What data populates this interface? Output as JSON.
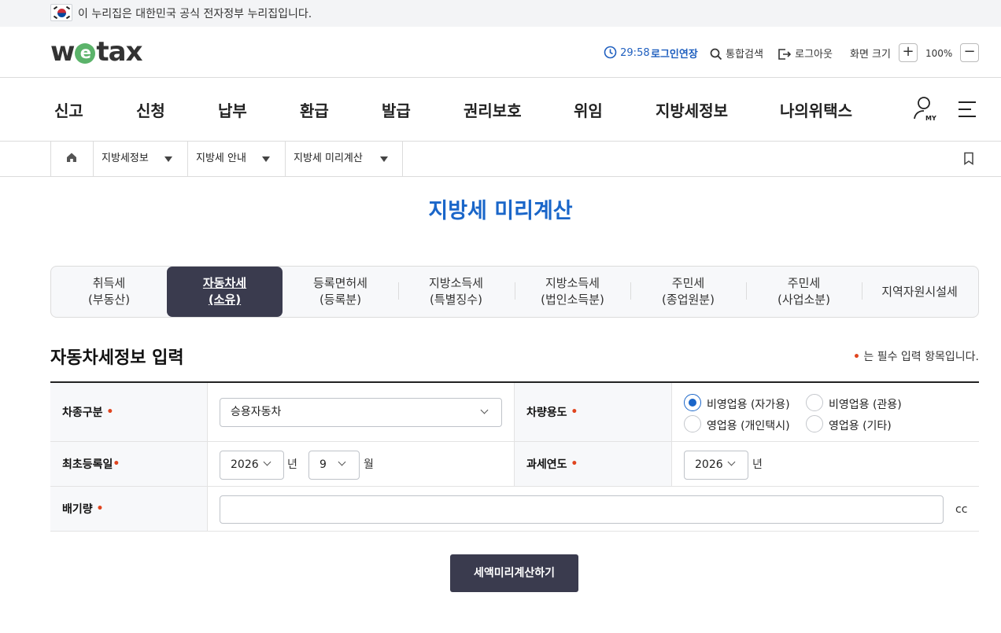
{
  "banner": {
    "text": "이 누리집은 대한민국 공식 전자정부 누리집입니다."
  },
  "header": {
    "logo": {
      "pre": "w",
      "mid": "e",
      "post": "tax"
    },
    "timer": "29:58",
    "extend_login": "로그인연장",
    "search": "통합검색",
    "logout": "로그아웃",
    "screen_size": "화면 크기",
    "zoom_in": "+",
    "zoom_level": "100%",
    "zoom_out": "−"
  },
  "gnb": [
    "신고",
    "신청",
    "납부",
    "환급",
    "발급",
    "권리보호",
    "위임",
    "지방세정보",
    "나의위택스"
  ],
  "my_badge": "MY",
  "breadcrumb": [
    "지방세정보",
    "지방세 안내",
    "지방세 미리계산"
  ],
  "page_title": "지방세 미리계산",
  "tabs": [
    {
      "l1": "취득세",
      "l2": "(부동산)"
    },
    {
      "l1": "자동차세",
      "l2": "(소유)"
    },
    {
      "l1": "등록면허세",
      "l2": "(등록분)"
    },
    {
      "l1": "지방소득세",
      "l2": "(특별징수)"
    },
    {
      "l1": "지방소득세",
      "l2": "(법인소득분)"
    },
    {
      "l1": "주민세",
      "l2": "(종업원분)"
    },
    {
      "l1": "주민세",
      "l2": "(사업소분)"
    },
    {
      "l1": "지역자원시설세",
      "l2": ""
    }
  ],
  "section_title": "자동차세정보 입력",
  "required_note": "는 필수 입력 항목입니다.",
  "form": {
    "vehicle_type_label": "차종구분",
    "vehicle_type_value": "승용자동차",
    "usage_label": "차량용도",
    "usage_options": [
      "비영업용 (자가용)",
      "비영업용 (관용)",
      "영업용 (개인택시)",
      "영업용 (기타)"
    ],
    "reg_date_label": "최초등록일",
    "reg_year": "2026",
    "year_unit": "년",
    "reg_month": "9",
    "month_unit": "월",
    "tax_year_label": "과세연도",
    "tax_year": "2026",
    "displacement_label": "배기량",
    "displacement_value": "",
    "cc_unit": "cc"
  },
  "calc_button": "세액미리계산하기"
}
